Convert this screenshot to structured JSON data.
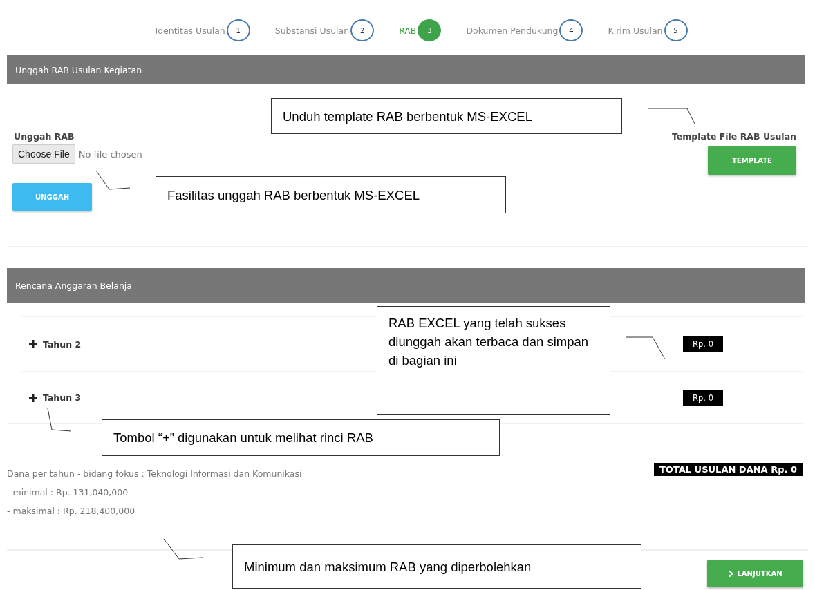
{
  "steps": [
    {
      "label": "Identitas Usulan",
      "number": "1",
      "selected": false
    },
    {
      "label": "Substansi Usulan",
      "number": "2",
      "selected": false
    },
    {
      "label": "RAB",
      "number": "3",
      "selected": true
    },
    {
      "label": "Dokumen Pendukung",
      "number": "4",
      "selected": false
    },
    {
      "label": "Kirim Usulan",
      "number": "5",
      "selected": false
    }
  ],
  "upload_panel": {
    "title": "Unggah RAB Usulan Kegiatan",
    "upload_label": "Unggah RAB",
    "file_button": "Choose File",
    "file_status": "No file chosen",
    "upload_button": "UNGGAH",
    "template_label": "Template File RAB Usulan",
    "template_button": "TEMPLATE"
  },
  "budget_panel": {
    "title": "Rencana Anggaran Belanja",
    "years": [
      {
        "label": "Tahun 2",
        "amount": "Rp. 0"
      },
      {
        "label": "Tahun 3",
        "amount": "Rp. 0"
      }
    ],
    "funding_note": "Dana per tahun - bidang fokus : Teknologi Informasi dan Komunikasi",
    "minimum": "- minimal : Rp. 131,040,000",
    "maximum": "- maksimal : Rp. 218,400,000",
    "total": "TOTAL USULAN DANA Rp. 0"
  },
  "next_button": "LANJUTKAN",
  "annotations": [
    {
      "text": "Unduh template RAB berbentuk MS-EXCEL"
    },
    {
      "text": "Fasilitas unggah RAB berbentuk MS-EXCEL"
    },
    {
      "text": "RAB EXCEL yang telah sukses diunggah akan terbaca dan simpan di bagian ini"
    },
    {
      "text": "Tombol “+” digunakan untuk melihat rinci RAB"
    },
    {
      "text": "Minimum dan maksimum RAB yang diperbolehkan"
    }
  ]
}
